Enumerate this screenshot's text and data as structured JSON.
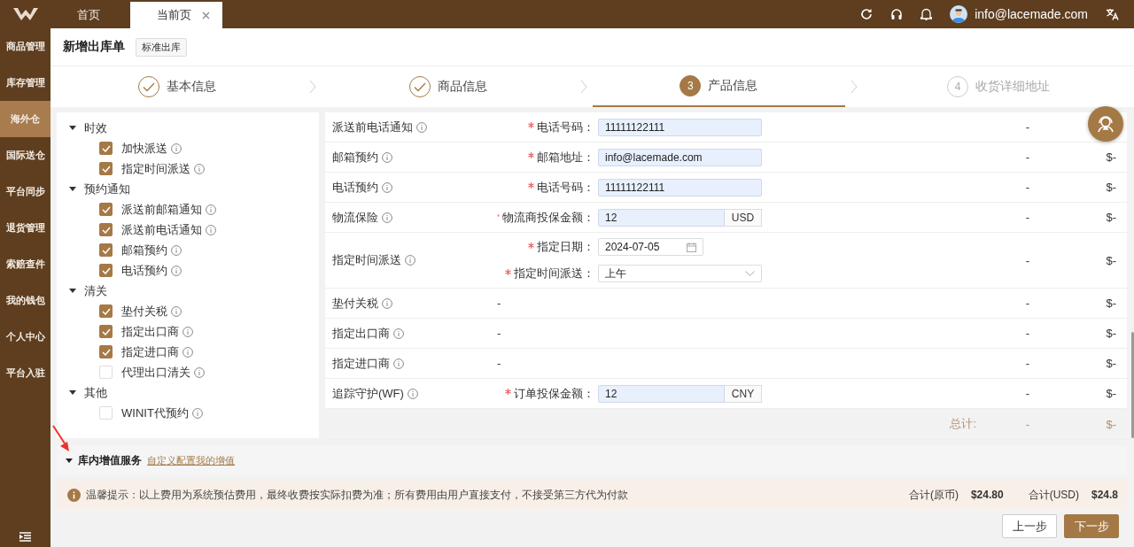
{
  "sidebar": {
    "items": [
      {
        "label": "商品管理",
        "selected": false
      },
      {
        "label": "库存管理",
        "selected": false
      },
      {
        "label": "海外仓",
        "selected": true
      },
      {
        "label": "国际送仓",
        "selected": false
      },
      {
        "label": "平台同步",
        "selected": false
      },
      {
        "label": "退货管理",
        "selected": false
      },
      {
        "label": "索赔查件",
        "selected": false
      },
      {
        "label": "我的钱包",
        "selected": false
      },
      {
        "label": "个人中心",
        "selected": false
      },
      {
        "label": "平台入驻",
        "selected": false
      }
    ]
  },
  "topbar": {
    "tabs": [
      {
        "label": "首页",
        "selected": false,
        "closable": false
      },
      {
        "label": "当前页",
        "selected": true,
        "closable": true
      }
    ],
    "user": "info@lacemade.com"
  },
  "page": {
    "title": "新增出库单",
    "tag": "标准出库"
  },
  "steps": [
    {
      "label": "基本信息",
      "done": true,
      "selected": false
    },
    {
      "label": "商品信息",
      "done": true,
      "selected": false
    },
    {
      "label": "产品信息",
      "number": "3",
      "done": false,
      "selected": true
    },
    {
      "label": "收货详细地址",
      "number": "4",
      "done": false,
      "selected": false
    }
  ],
  "tree": [
    {
      "label": "时效",
      "expanded": true,
      "children": [
        {
          "label": "加快派送",
          "checked": true
        },
        {
          "label": "指定时间派送",
          "checked": true
        }
      ]
    },
    {
      "label": "预约通知",
      "expanded": true,
      "children": [
        {
          "label": "派送前邮箱通知",
          "checked": true
        },
        {
          "label": "派送前电话通知",
          "checked": true
        },
        {
          "label": "邮箱预约",
          "checked": true
        },
        {
          "label": "电话预约",
          "checked": true
        }
      ]
    },
    {
      "label": "清关",
      "expanded": true,
      "children": [
        {
          "label": "垫付关税",
          "checked": true
        },
        {
          "label": "指定出口商",
          "checked": true
        },
        {
          "label": "指定进口商",
          "checked": true
        },
        {
          "label": "代理出口清关",
          "checked": false
        }
      ]
    },
    {
      "label": "其他",
      "expanded": true,
      "children": [
        {
          "label": "WINIT代预约",
          "checked": false
        }
      ]
    }
  ],
  "services": {
    "rows": [
      {
        "name": "派送前电话通知",
        "fields": [
          {
            "label": "电话号码：",
            "required": true,
            "kind": "text",
            "value": "11111122111"
          }
        ],
        "value": "-"
      },
      {
        "name": "邮箱预约",
        "fields": [
          {
            "label": "邮箱地址：",
            "required": true,
            "kind": "text",
            "value": "info@lacemade.com"
          }
        ],
        "value": "-",
        "price": "$-"
      },
      {
        "name": "电话预约",
        "fields": [
          {
            "label": "电话号码：",
            "required": true,
            "kind": "text",
            "value": "11111122111"
          }
        ],
        "value": "-",
        "price": "$-"
      },
      {
        "name": "物流保险",
        "fields": [
          {
            "label": "物流商投保金额：",
            "required": true,
            "kind": "amount",
            "value": "12",
            "suffix": "USD"
          }
        ],
        "value": "-",
        "price": "$-"
      },
      {
        "name": "指定时间派送",
        "fields": [
          {
            "label": "指定日期：",
            "required": true,
            "kind": "date",
            "value": "2024-07-05"
          },
          {
            "label": "指定时间派送：",
            "required": true,
            "kind": "select",
            "value": "上午"
          }
        ],
        "value": "-",
        "price": "$-"
      },
      {
        "name": "垫付关税",
        "empty": "-",
        "value": "-",
        "price": "$-"
      },
      {
        "name": "指定出口商",
        "empty": "-",
        "value": "-",
        "price": "$-"
      },
      {
        "name": "指定进口商",
        "empty": "-",
        "value": "-",
        "price": "$-"
      },
      {
        "name": "追踪守护(WF)",
        "fields": [
          {
            "label": "订单投保金额：",
            "required": true,
            "kind": "amount",
            "value": "12",
            "suffix": "CNY"
          }
        ],
        "value": "-",
        "price": "$-"
      }
    ],
    "total": {
      "label": "总计:",
      "value": "-",
      "price": "$-"
    }
  },
  "value_added": {
    "title": "库内增值服务",
    "link": "自定义配置我的增值",
    "expanded": true
  },
  "notice": {
    "text": "温馨提示：以上费用为系统预估费用，最终收费按实际扣费为准；所有费用由用户直接支付，不接受第三方代为付款",
    "totals": [
      {
        "label": "合计(原币)",
        "value": "$24.80"
      },
      {
        "label": "合计(USD)",
        "value": "$24.8"
      }
    ]
  },
  "buttons": [
    {
      "label": "上一步",
      "kind": "secondary"
    },
    {
      "label": "下一步",
      "kind": "primary"
    }
  ]
}
